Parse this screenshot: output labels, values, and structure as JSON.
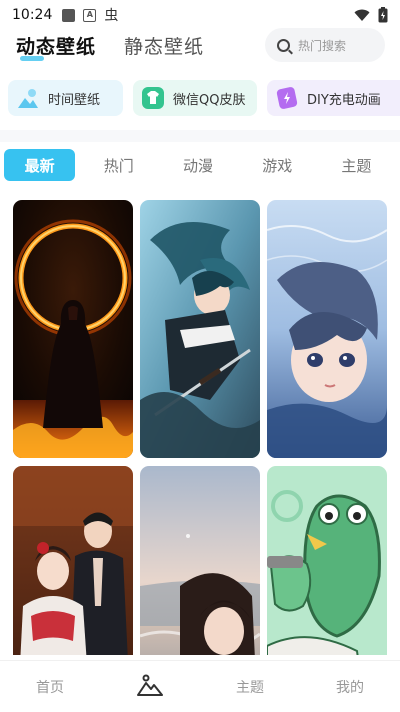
{
  "status_bar": {
    "time": "10:24",
    "icons": [
      "square-notification-icon",
      "app-a-icon",
      "bug-icon",
      "wifi-icon",
      "battery-icon"
    ]
  },
  "header": {
    "tab_dynamic": "动态壁纸",
    "tab_static": "静态壁纸",
    "search_placeholder": "热门搜索"
  },
  "categories": [
    {
      "label": "时间壁纸",
      "icon": "clock-landscape-icon",
      "color": "#5cc7ef"
    },
    {
      "label": "微信QQ皮肤",
      "icon": "shirt-icon",
      "color": "#33c48f"
    },
    {
      "label": "DIY充电动画",
      "icon": "battery-card-icon",
      "color": "#b46cf0"
    }
  ],
  "sub_tabs": [
    "最新",
    "热门",
    "动漫",
    "游戏",
    "主题"
  ],
  "active_sub_tab": "最新",
  "wallpapers": [
    {
      "name": "fire-ring-hooded-figure"
    },
    {
      "name": "anime-swordsman-teal-hair"
    },
    {
      "name": "anime-girl-underwater"
    },
    {
      "name": "couple-traditional-costume"
    },
    {
      "name": "woman-beach-sunset"
    },
    {
      "name": "cartoon-frogs"
    }
  ],
  "bottom_nav": {
    "home": "首页",
    "theme": "主题",
    "mine": "我的"
  },
  "colors": {
    "accent": "#37c2f0",
    "inactive_text": "#777777"
  }
}
